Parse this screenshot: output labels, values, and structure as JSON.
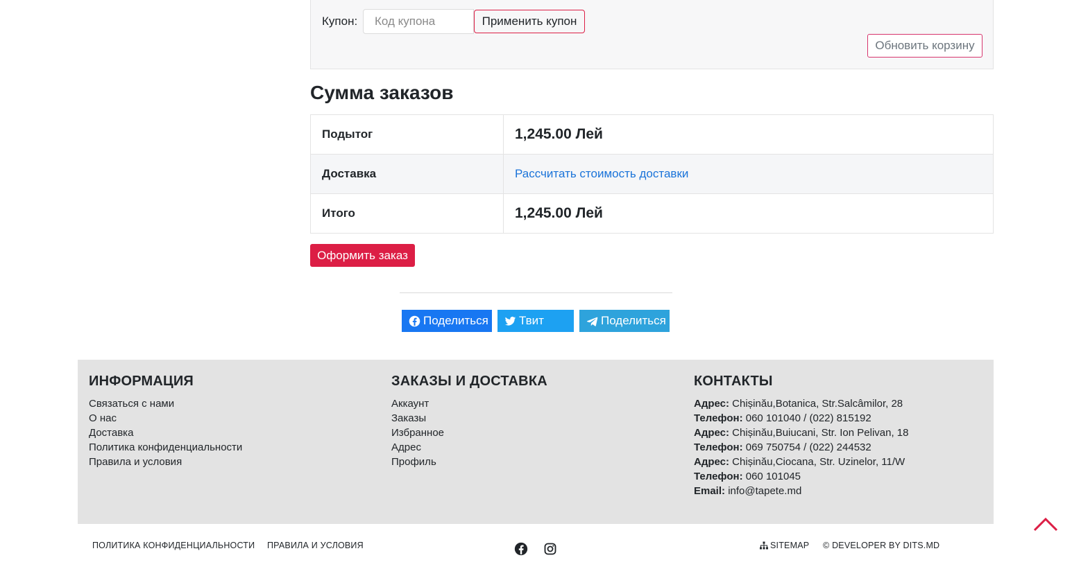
{
  "coupon": {
    "label": "Купон:",
    "placeholder": "Код купона",
    "apply_label": "Применить купон",
    "update_label": "Обновить корзину"
  },
  "totals": {
    "title": "Сумма заказов",
    "rows": [
      {
        "label": "Подытог",
        "value": "1,245.00 Лей"
      },
      {
        "label": "Доставка",
        "value": "Рассчитать стоимость доставки"
      },
      {
        "label": "Итого",
        "value": "1,245.00 Лей"
      }
    ],
    "checkout_label": "Оформить заказ"
  },
  "share": {
    "facebook_label": "Поделиться",
    "twitter_label": "Твит",
    "telegram_label": "Поделиться"
  },
  "footer": {
    "info": {
      "title": "ИНФОРМАЦИЯ",
      "links": [
        "Связаться с нами",
        "О нас",
        "Доставка",
        "Политика конфиденциальности",
        "Правила и условия"
      ]
    },
    "orders": {
      "title": "ЗАКАЗЫ И ДОСТАВКА",
      "links": [
        "Аккаунт",
        "Заказы",
        "Избранное",
        "Адрес",
        "Профиль"
      ]
    },
    "contacts": {
      "title": "КОНТАКТЫ",
      "items": [
        {
          "label": "Адрес:",
          "value": "Chișinău,Botanica, Str.Salcâmilor, 28"
        },
        {
          "label": "Телефон:",
          "value": "060 101040 / (022) 815192"
        },
        {
          "label": "Адрес:",
          "value": "Chișinău,Buiucani, Str. Ion Pelivan, 18"
        },
        {
          "label": "Телефон:",
          "value": "069 750754 / (022) 244532"
        },
        {
          "label": "Адрес:",
          "value": "Chișinău,Ciocana, Str. Uzinelor, 11/W"
        },
        {
          "label": "Телефон:",
          "value": "060 101045"
        },
        {
          "label": "Email:",
          "value": "info@tapete.md"
        }
      ]
    }
  },
  "bottom": {
    "privacy": "Политика конфиденциальности",
    "terms": "Правила и условия",
    "sitemap": "Sitemap",
    "developer": "© Developer by dits.md",
    "social_icons": [
      "facebook-icon",
      "instagram-icon"
    ]
  },
  "colors": {
    "accent": "#dc1e45",
    "link": "#1a73d9",
    "facebook": "#1877f2",
    "twitter": "#1da1f2",
    "telegram": "#2ea3dc",
    "footer_bg": "#e3e3e3"
  }
}
